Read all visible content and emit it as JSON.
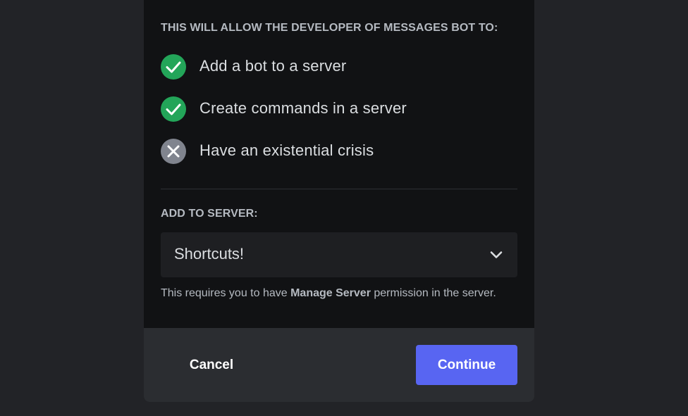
{
  "authorize": {
    "permissions_heading": "THIS WILL ALLOW THE DEVELOPER OF MESSAGES BOT TO:",
    "permissions": [
      {
        "label": "Add a bot to a server",
        "status": "granted",
        "icon": "check-icon"
      },
      {
        "label": "Create commands in a server",
        "status": "granted",
        "icon": "check-icon"
      },
      {
        "label": "Have an existential crisis",
        "status": "denied",
        "icon": "x-icon"
      }
    ],
    "server_heading": "ADD TO SERVER:",
    "server_select": {
      "value": "Shortcuts!",
      "icon": "chevron-down-icon"
    },
    "helper": {
      "prefix": "This requires you to have ",
      "bold": "Manage Server",
      "suffix": " permission in the server."
    }
  },
  "footer": {
    "cancel_label": "Cancel",
    "continue_label": "Continue"
  },
  "colors": {
    "background": "#222327",
    "modal": "#111214",
    "footer": "#2b2d31",
    "granted": "#23a559",
    "denied": "#80848e",
    "accent": "#5865f2"
  }
}
